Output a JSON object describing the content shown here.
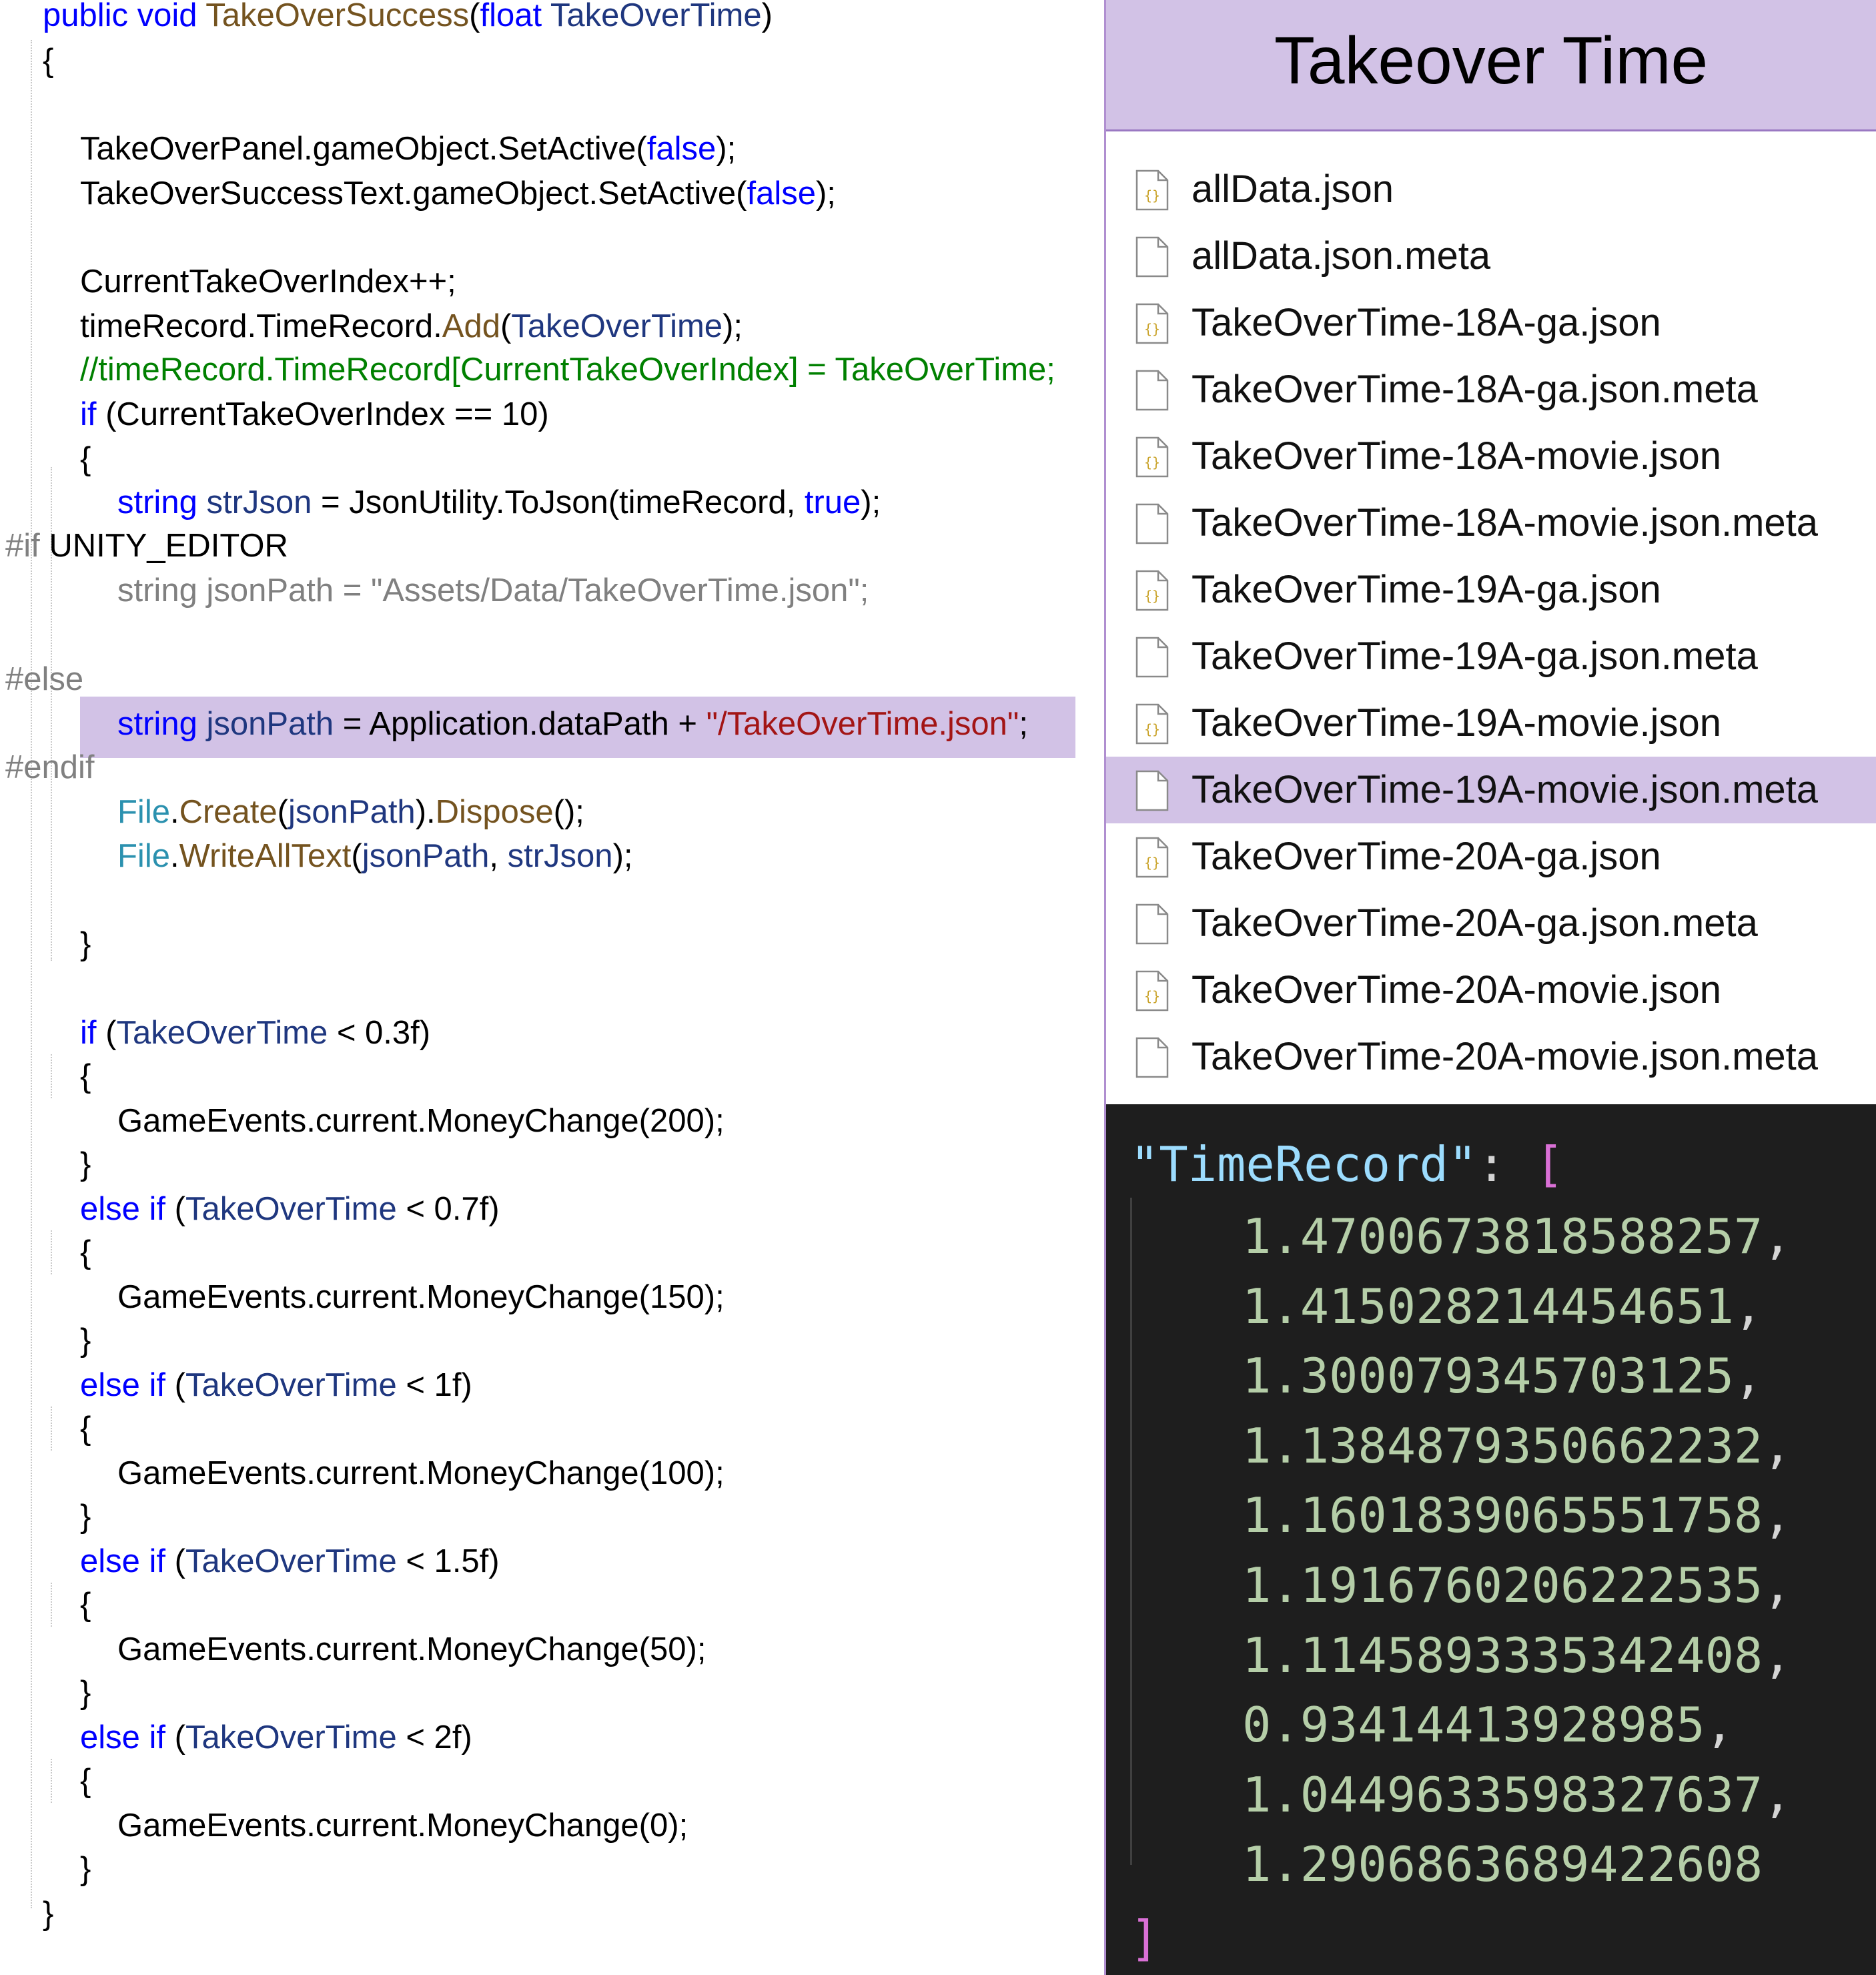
{
  "title": "Takeover Time",
  "code": {
    "signature": {
      "kw1": "public",
      "kw2": "void",
      "method": "TakeOverSuccess",
      "type": "float",
      "param": "TakeOverTime"
    },
    "line_set_active_panel": {
      "a": "TakeOverPanel.gameObject.SetActive(",
      "b": "false",
      "c": ");"
    },
    "line_set_active_text": {
      "a": "TakeOverSuccessText.gameObject.SetActive(",
      "b": "false",
      "c": ");"
    },
    "line_increment": "CurrentTakeOverIndex++;",
    "line_add": {
      "a": "timeRecord.TimeRecord.",
      "b": "Add",
      "c": "(",
      "d": "TakeOverTime",
      "e": ");"
    },
    "line_comment": "//timeRecord.TimeRecord[CurrentTakeOverIndex] = TakeOverTime;",
    "line_if_index": {
      "kw": "if",
      "rest": " (CurrentTakeOverIndex == 10)"
    },
    "line_tojson": {
      "kw": "string",
      "var": "strJson",
      "eq": " = JsonUtility.ToJson(timeRecord, ",
      "kw2": "true",
      "end": ");"
    },
    "pp_if": {
      "kw": "#if",
      "rest": " UNITY_EDITOR"
    },
    "line_editor_path": "string jsonPath = \"Assets/Data/TakeOverTime.json\";",
    "pp_else": "#else",
    "line_runtime_path": {
      "kw": "string",
      "var": "jsonPath",
      "eq": " = Application.dataPath + ",
      "str": "\"/TakeOverTime.json\"",
      "end": ";"
    },
    "pp_endif": "#endif",
    "line_create": {
      "ty": "File",
      "dot": ".",
      "fn": "Create",
      "p1": "(",
      "id": "jsonPath",
      "p2": ").",
      "fn2": "Dispose",
      "p3": "();"
    },
    "line_write": {
      "ty": "File",
      "dot": ".",
      "fn": "WriteAllText",
      "p1": "(",
      "id1": "jsonPath",
      "sep": ", ",
      "id2": "strJson",
      "p2": ");"
    },
    "brace_open": "{",
    "brace_close": "}",
    "kw_if": "if",
    "kw_else_if": "else if",
    "param_name": "TakeOverTime",
    "cond1": " < 0.3f)",
    "cond2": " < 0.7f)",
    "cond3": " < 1f)",
    "cond4": " < 1.5f)",
    "cond5": " < 2f)",
    "paren_open": " (",
    "paren_open_nospace": "(",
    "money200": "GameEvents.current.MoneyChange(200);",
    "money150": "GameEvents.current.MoneyChange(150);",
    "money100": "GameEvents.current.MoneyChange(100);",
    "money50": "GameEvents.current.MoneyChange(50);",
    "money0": "GameEvents.current.MoneyChange(0);"
  },
  "files": [
    {
      "name": "allData.json",
      "icon": "json-file-icon"
    },
    {
      "name": "allData.json.meta",
      "icon": "file-icon"
    },
    {
      "name": "TakeOverTime-18A-ga.json",
      "icon": "json-file-icon"
    },
    {
      "name": "TakeOverTime-18A-ga.json.meta",
      "icon": "file-icon"
    },
    {
      "name": "TakeOverTime-18A-movie.json",
      "icon": "json-file-icon"
    },
    {
      "name": "TakeOverTime-18A-movie.json.meta",
      "icon": "file-icon"
    },
    {
      "name": "TakeOverTime-19A-ga.json",
      "icon": "json-file-icon"
    },
    {
      "name": "TakeOverTime-19A-ga.json.meta",
      "icon": "file-icon"
    },
    {
      "name": "TakeOverTime-19A-movie.json",
      "icon": "json-file-icon"
    },
    {
      "name": "TakeOverTime-19A-movie.json.meta",
      "icon": "file-icon",
      "selected": true
    },
    {
      "name": "TakeOverTime-20A-ga.json",
      "icon": "json-file-icon"
    },
    {
      "name": "TakeOverTime-20A-ga.json.meta",
      "icon": "file-icon"
    },
    {
      "name": "TakeOverTime-20A-movie.json",
      "icon": "json-file-icon"
    },
    {
      "name": "TakeOverTime-20A-movie.json.meta",
      "icon": "file-icon"
    }
  ],
  "json_view": {
    "key": "\"TimeRecord\"",
    "colon": ": ",
    "open": "[",
    "close": "]",
    "values": [
      "1.4700673818588257",
      "1.415028214454651",
      "1.300079345703125",
      "1.1384879350662232",
      "1.1601839065551758",
      "1.1916760206222535",
      "1.1145893335342408",
      "0.93414413928985",
      "1.0449633598327637",
      "1.2906863689422608"
    ],
    "comma": ","
  },
  "colors": {
    "accent_purple": "#d2c2e6",
    "border_purple": "#b08fd0",
    "json_bg": "#1e1e1e",
    "json_number": "#b5cea8",
    "json_key": "#9cdcfe",
    "json_bracket": "#da70d6"
  }
}
